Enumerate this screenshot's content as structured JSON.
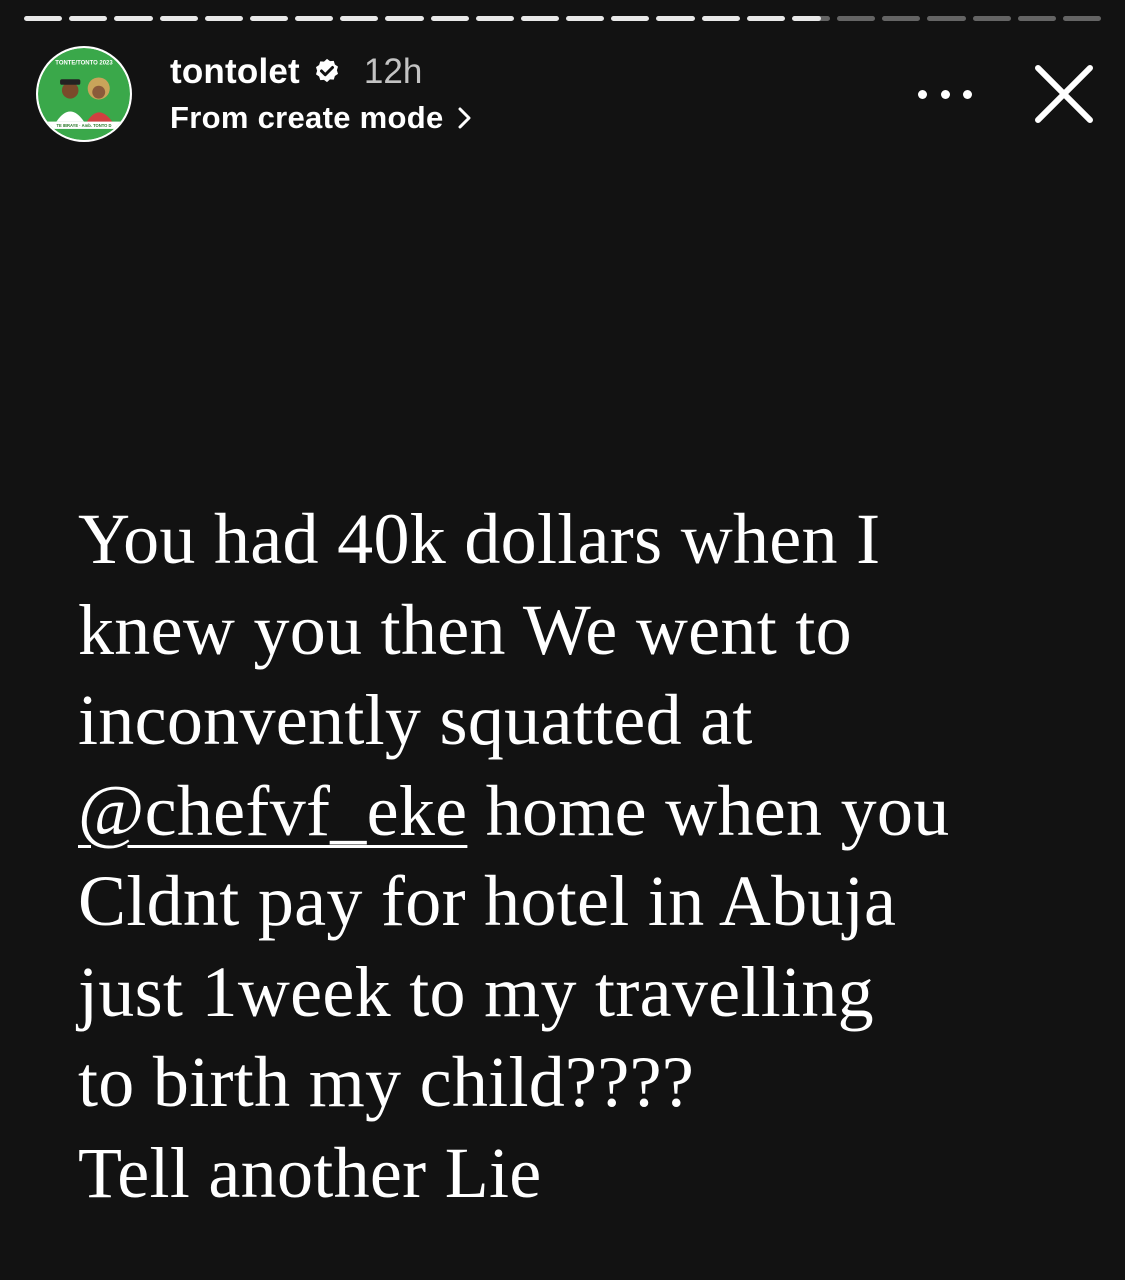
{
  "story": {
    "progress": {
      "total_segments": 24,
      "completed_segments": 17,
      "current_segment_fill": 0.75
    },
    "header": {
      "username": "tontolet",
      "time_ago": "12h",
      "subtitle": "From create mode",
      "avatar_text": {
        "top": "TONTE/TONTO 2023",
        "bottom": "TE IBRAYE · Amb. TONTO D"
      }
    },
    "text": {
      "line1": "You had 40k dollars when I",
      "line2": "knew you then We went to",
      "line3": "inconvently squatted at",
      "mention": "@chefvf_eke",
      "line4_rest": " home when you",
      "line5": "Cldnt pay for hotel in Abuja",
      "line6": "just 1week to my travelling",
      "line7": "to birth my child????",
      "line8": "Tell another Lie"
    },
    "colors": {
      "background": "#121212",
      "text": "#ffffff",
      "avatar_green": "#3aa84a"
    },
    "icons": {
      "verified": "verified-badge-icon",
      "more": "more-options-icon",
      "close": "close-icon",
      "chevron": "chevron-right-icon"
    }
  }
}
